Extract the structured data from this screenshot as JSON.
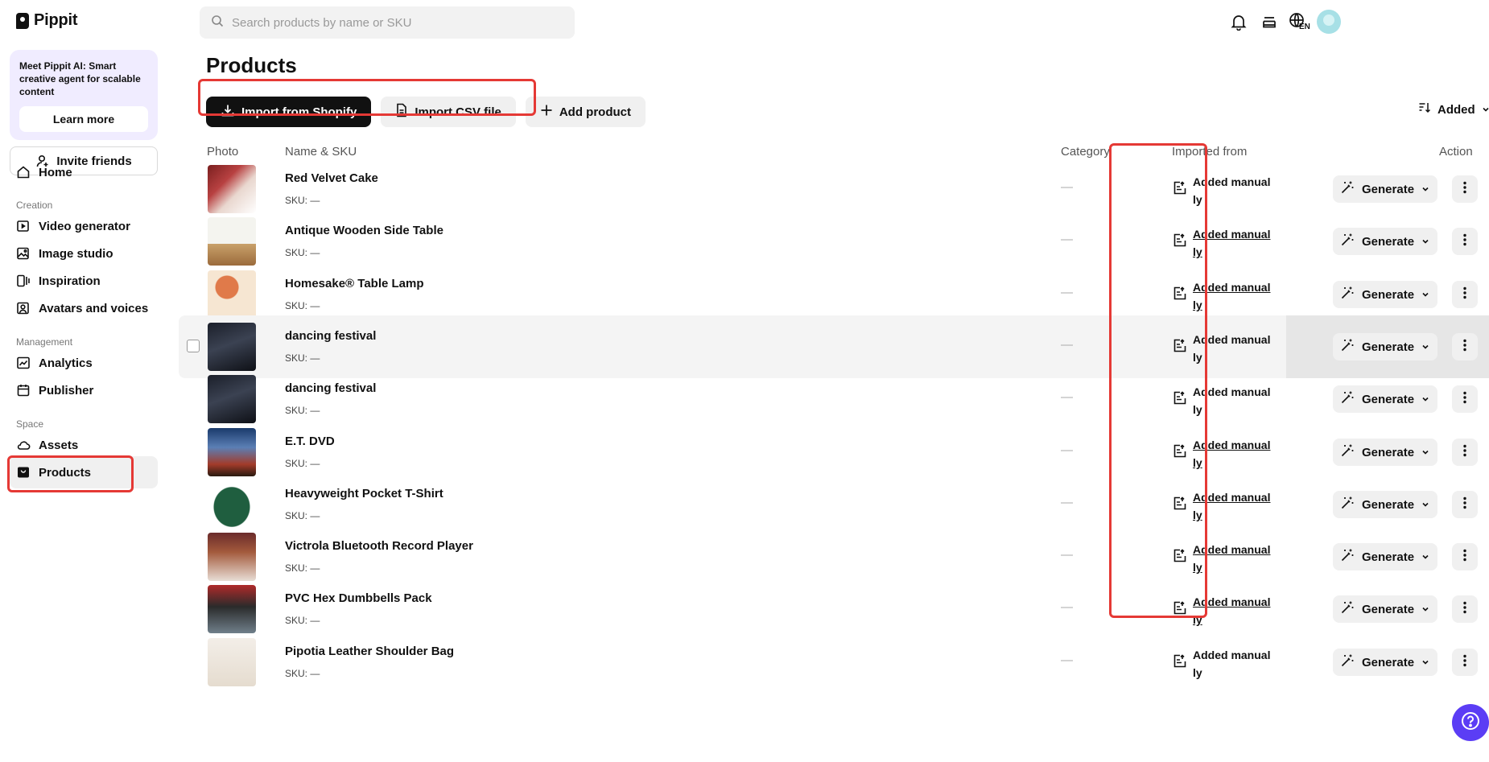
{
  "app": {
    "name": "Pippit"
  },
  "sidebar": {
    "promo": {
      "text": "Meet Pippit AI: Smart creative agent for scalable content",
      "button": "Learn more"
    },
    "invite": "Invite friends",
    "home": "Home",
    "creation_title": "Creation",
    "creation": [
      "Video generator",
      "Image studio",
      "Inspiration",
      "Avatars and voices"
    ],
    "management_title": "Management",
    "management": [
      "Analytics",
      "Publisher"
    ],
    "space_title": "Space",
    "space": [
      "Assets",
      "Products"
    ]
  },
  "header": {
    "search_placeholder": "Search products by name or SKU",
    "language": "EN"
  },
  "main": {
    "title": "Products",
    "toolbar": {
      "import_shopify": "Import from Shopify",
      "import_csv": "Import CSV file",
      "add_product": "Add product"
    },
    "sort_label": "Added",
    "columns": {
      "photo": "Photo",
      "name_sku": "Name & SKU",
      "category": "Category",
      "imported_from": "Imported from",
      "action": "Action"
    },
    "generate_label": "Generate",
    "products": [
      {
        "name": "Red Velvet Cake",
        "sku": "SKU: —",
        "category": "—",
        "imported_line1": "Added manual",
        "imported_line2": "ly",
        "underlined": false
      },
      {
        "name": "Antique Wooden Side Table",
        "sku": "SKU: —",
        "category": "—",
        "imported_line1": "Added manual",
        "imported_line2": "ly",
        "underlined": true
      },
      {
        "name": "Homesake® Table Lamp",
        "sku": "SKU: —",
        "category": "—",
        "imported_line1": "Added manual",
        "imported_line2": "ly",
        "underlined": true
      },
      {
        "name": "dancing festival",
        "sku": "SKU: —",
        "category": "—",
        "imported_line1": "Added manual",
        "imported_line2": "ly",
        "underlined": false
      },
      {
        "name": "dancing festival",
        "sku": "SKU: —",
        "category": "—",
        "imported_line1": "Added manual",
        "imported_line2": "ly",
        "underlined": false
      },
      {
        "name": "E.T. DVD",
        "sku": "SKU: —",
        "category": "—",
        "imported_line1": "Added manual",
        "imported_line2": "ly",
        "underlined": true
      },
      {
        "name": "Heavyweight Pocket T-Shirt",
        "sku": "SKU: —",
        "category": "—",
        "imported_line1": "Added manual",
        "imported_line2": "ly",
        "underlined": true
      },
      {
        "name": "Victrola Bluetooth Record Player",
        "sku": "SKU: —",
        "category": "—",
        "imported_line1": "Added manual",
        "imported_line2": "ly",
        "underlined": true
      },
      {
        "name": "PVC Hex Dumbbells Pack",
        "sku": "SKU: —",
        "category": "—",
        "imported_line1": "Added manual",
        "imported_line2": "ly",
        "underlined": true
      },
      {
        "name": "Pipotia Leather Shoulder Bag",
        "sku": "SKU: —",
        "category": "—",
        "imported_line1": "Added manual",
        "imported_line2": "ly",
        "underlined": false
      }
    ]
  },
  "colors": {
    "accent": "#5b3df5",
    "highlight": "#e53935",
    "primary_button": "#111111"
  }
}
